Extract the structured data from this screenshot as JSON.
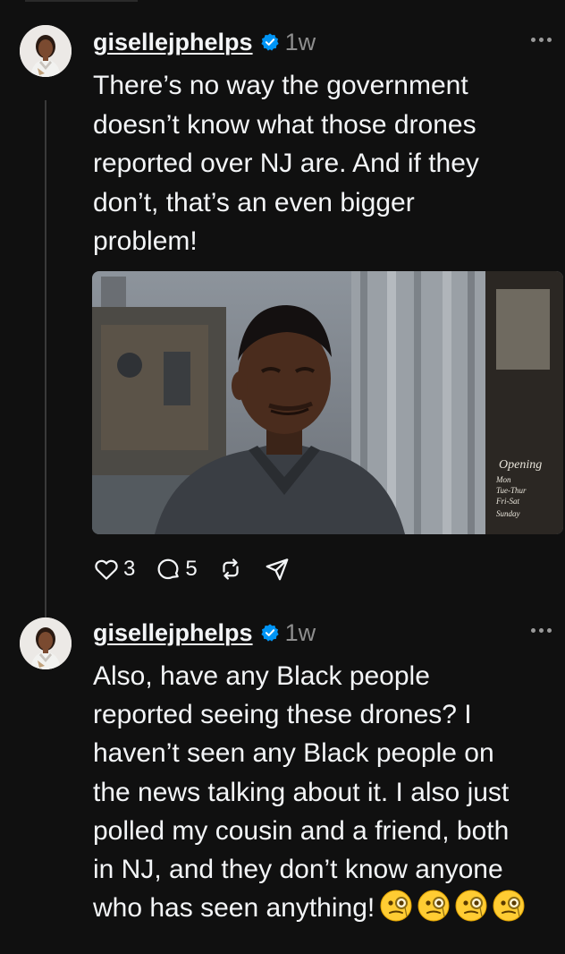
{
  "posts": [
    {
      "username": "gisellejphelps",
      "time": "1w",
      "text": "There’s no way the government\ndoesn’t know what those drones\nreported over NJ are. And if they\ndon’t, that’s an even bigger\nproblem!",
      "image": {
        "sign_lines": [
          "Opening",
          "Mon",
          "Tue-Thur",
          "Fri-Sat",
          "Sunday"
        ]
      },
      "counts": {
        "likes": "3",
        "replies": "5"
      }
    },
    {
      "username": "gisellejphelps",
      "time": "1w",
      "text": "Also, have any Black people\nreported seeing these drones? I\nhaven’t seen any Black people on\nthe news talking about it. I also just\npolled my cousin and a friend, both\nin NJ, and they don’t know anyone\nwho has seen anything!",
      "emoji_count": 4
    }
  ],
  "icons": {
    "verified": "verified-badge-icon",
    "more": "more-options-icon",
    "like": "heart-icon",
    "reply": "comment-icon",
    "repost": "repost-icon",
    "share": "share-icon",
    "emoji": "face-with-monocle-emoji"
  },
  "colors": {
    "background": "#101010",
    "text": "#f3f5f7",
    "muted": "#8e8e8e",
    "verified": "#0095f6"
  }
}
